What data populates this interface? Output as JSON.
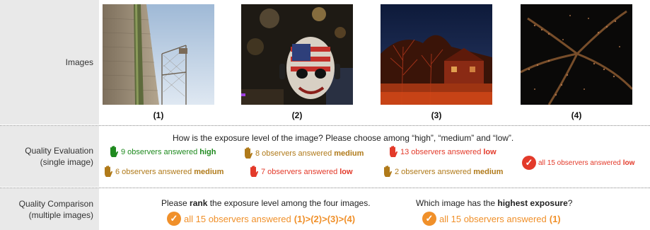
{
  "rows": {
    "images": "Images",
    "eval": [
      "Quality Evaluation",
      "(single image)"
    ],
    "compare": [
      "Quality Comparison",
      "(multiple images)"
    ]
  },
  "captions": [
    "(1)",
    "(2)",
    "(3)",
    "(4)"
  ],
  "evaluation": {
    "question": "How is the exposure level of the image? Please choose among “high”, “medium” and “low”.",
    "img1_top": {
      "prefix": "9 observers answered ",
      "answer": "high"
    },
    "img1_bottom": {
      "prefix": "6 observers answered ",
      "answer": "medium"
    },
    "img2_top": {
      "prefix": "8 observers answered ",
      "answer": "medium"
    },
    "img2_bottom": {
      "prefix": "7 observers answered ",
      "answer": "low"
    },
    "img3_top": {
      "prefix": "13 observers answered ",
      "answer": "low"
    },
    "img3_bottom": {
      "prefix": "2 observers answered ",
      "answer": "medium"
    },
    "img4": {
      "prefix": "all 15 observers answered ",
      "answer": "low"
    }
  },
  "comparison": {
    "rank_q": {
      "pre": "Please ",
      "bold": "rank",
      "post": " the exposure level among the four images."
    },
    "rank_a": {
      "prefix": "all 15 observers answered ",
      "answer": "(1)>(2)>(3)>(4)"
    },
    "high_q": {
      "pre": "Which image has the ",
      "bold": "highest exposure",
      "post": "?"
    },
    "high_a": {
      "prefix": "all 15 observers answered ",
      "answer": "(1)"
    }
  },
  "colors": {
    "high": "#1f8a1f",
    "medium": "#b07a1a",
    "low": "#e33a2a",
    "consensus": "#f0902a",
    "check_red": "#e33a2a"
  }
}
